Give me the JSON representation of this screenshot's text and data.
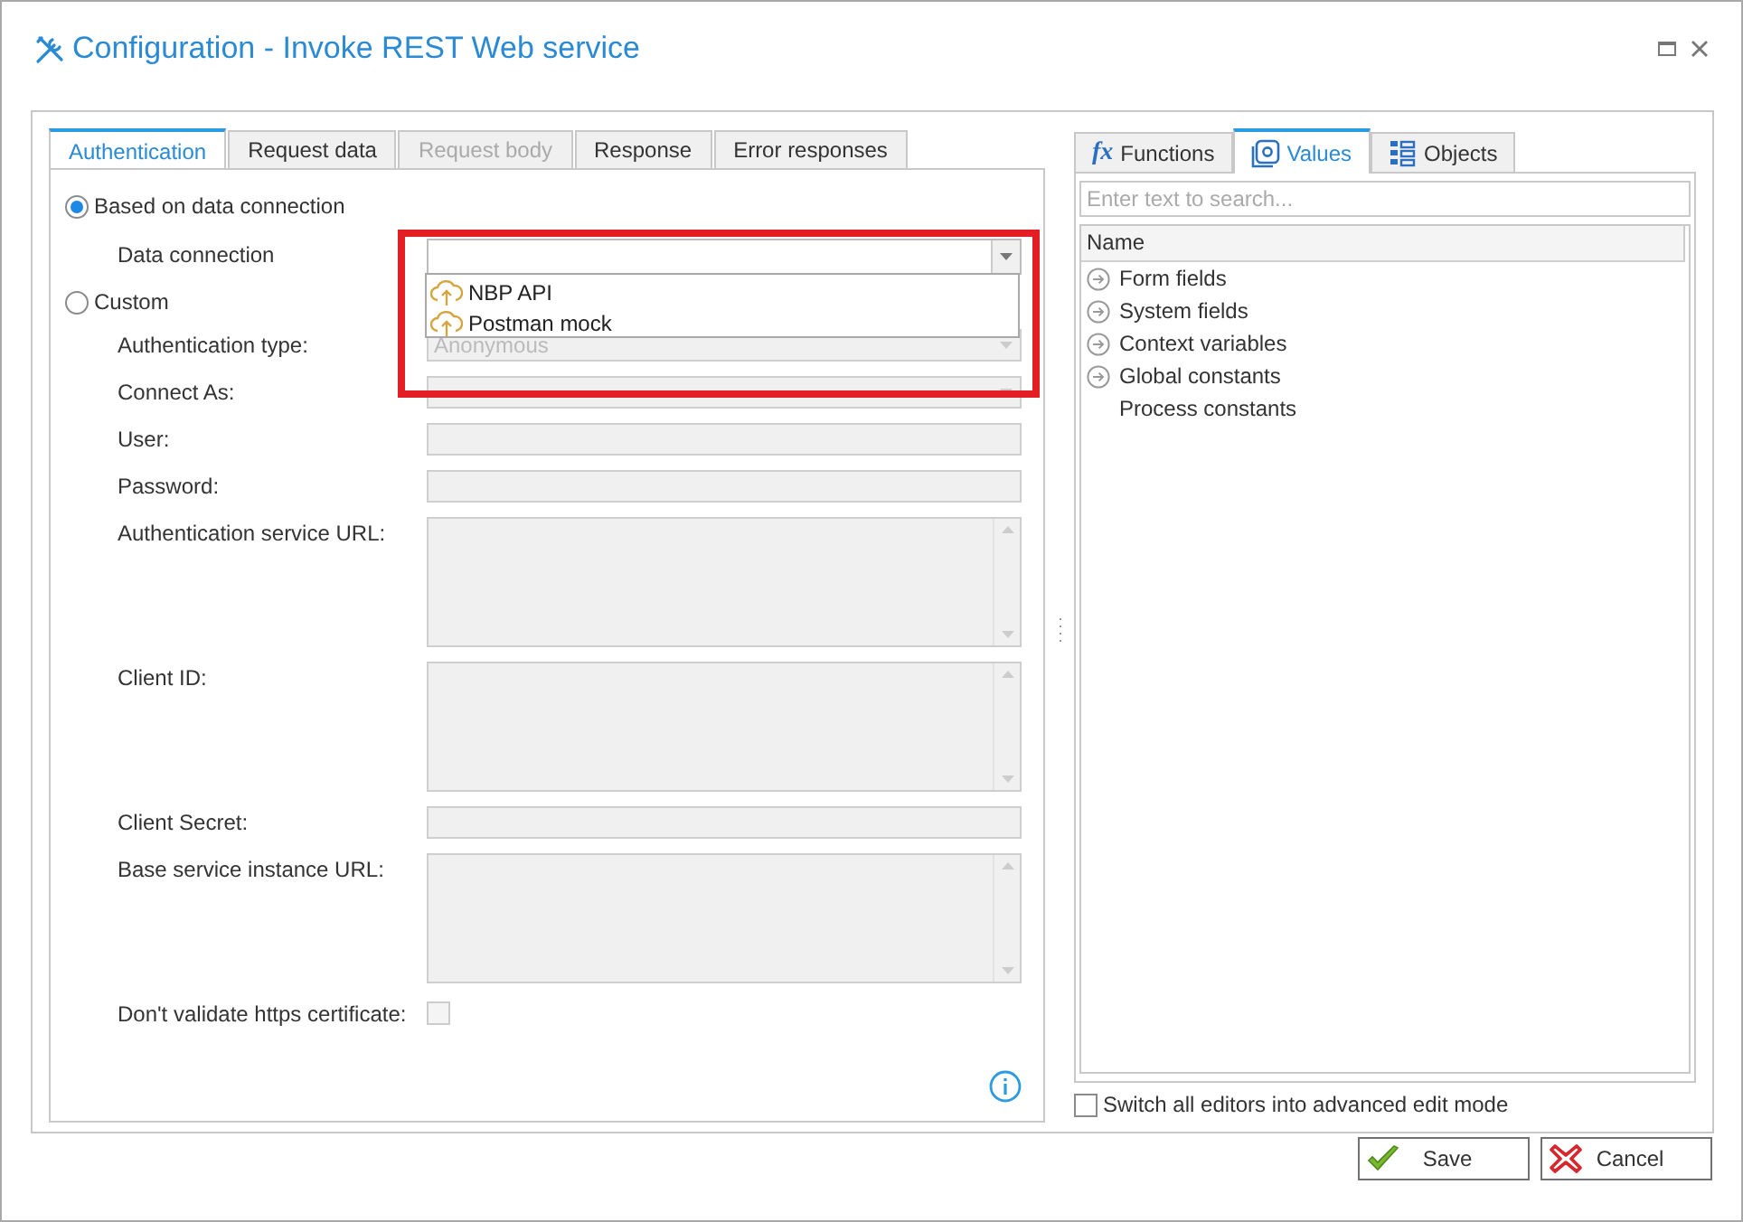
{
  "window": {
    "title": "Configuration - Invoke REST Web service"
  },
  "left_tabs": [
    {
      "label": "Authentication",
      "selected": true,
      "disabled": false
    },
    {
      "label": "Request data",
      "selected": false,
      "disabled": false
    },
    {
      "label": "Request body",
      "selected": false,
      "disabled": true
    },
    {
      "label": "Response",
      "selected": false,
      "disabled": false
    },
    {
      "label": "Error responses",
      "selected": false,
      "disabled": false
    }
  ],
  "connection_modes": [
    {
      "label": "Based on data connection",
      "selected": true,
      "fields": [
        {
          "label": "Data connection",
          "kind": "combo",
          "disabled": false,
          "expanded": true,
          "highlighted": true,
          "options": [
            "NBP API",
            "Postman mock"
          ]
        }
      ]
    },
    {
      "label": "Custom",
      "selected": false,
      "fields": [
        {
          "label": "Authentication type:",
          "kind": "combo",
          "disabled": true,
          "value": "Anonymous"
        },
        {
          "label": "Connect As:",
          "kind": "combo",
          "disabled": true
        },
        {
          "label": "User:",
          "kind": "text",
          "disabled": true
        },
        {
          "label": "Password:",
          "kind": "text",
          "disabled": true
        },
        {
          "label": "Authentication service URL:",
          "kind": "textarea",
          "disabled": true
        },
        {
          "label": "Client ID:",
          "kind": "textarea",
          "disabled": true
        },
        {
          "label": "Client Secret:",
          "kind": "text",
          "disabled": true
        },
        {
          "label": "Base service instance URL:",
          "kind": "textarea",
          "disabled": true
        },
        {
          "label": "Don't validate https certificate:",
          "kind": "checkbox",
          "disabled": true,
          "checked": false
        }
      ]
    }
  ],
  "right_tabs": [
    {
      "label": "Functions",
      "icon_text": "fx",
      "selected": false
    },
    {
      "label": "Values",
      "selected": true
    },
    {
      "label": "Objects",
      "selected": false
    }
  ],
  "search": {
    "placeholder": "Enter text to search..."
  },
  "tree": {
    "columns": [
      "Name"
    ],
    "items": [
      {
        "label": "Form fields",
        "kind": "group"
      },
      {
        "label": "System fields",
        "kind": "group"
      },
      {
        "label": "Context variables",
        "kind": "group"
      },
      {
        "label": "Global constants",
        "kind": "group"
      },
      {
        "label": "Process constants",
        "kind": "leaf"
      }
    ]
  },
  "advanced_mode": {
    "label": "Switch all editors into advanced edit mode",
    "checked": false
  },
  "buttons": [
    {
      "label": "Save",
      "kind": "save"
    },
    {
      "label": "Cancel",
      "kind": "cancel"
    }
  ]
}
